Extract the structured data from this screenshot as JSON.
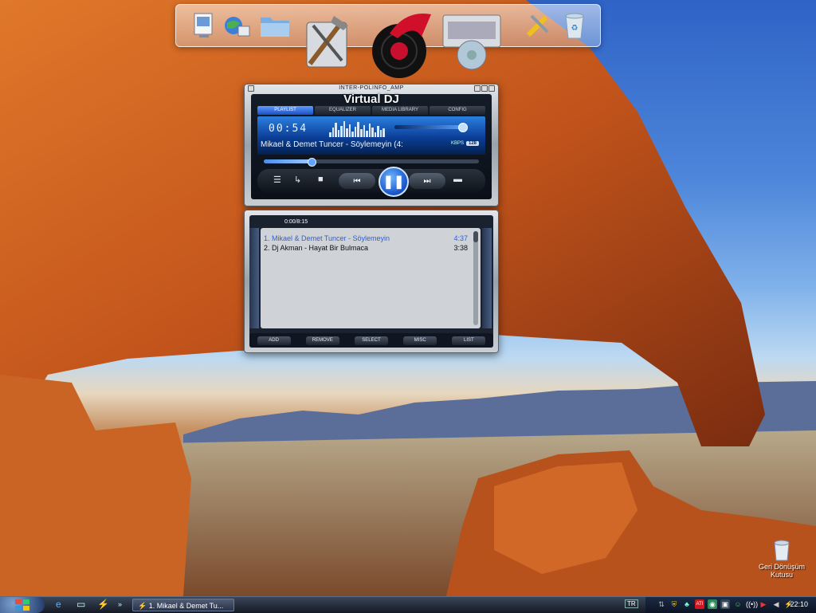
{
  "dock": {
    "items": [
      "display-settings-icon",
      "network-icon",
      "folder-icon",
      "tools-icon",
      "virtualdj-icon",
      "scanner-icon",
      "settings-icon",
      "recycle-bin-icon"
    ]
  },
  "player": {
    "window_title": "INTER-POLINFO_AMP",
    "app_title": "Virtual DJ",
    "tabs": [
      "PLAYLIST",
      "EQUALIZER",
      "MEDIA LIBRARY",
      "CONFIG"
    ],
    "active_tab": "PLAYLIST",
    "time": "00:54",
    "track_title": "Mikael & Demet Tuncer - Söylemeyin (4:",
    "kbps_label": "KBPS",
    "kbps_value": "128",
    "seek_fraction": 0.22,
    "accent": "#2f7fe6"
  },
  "playlist": {
    "time": "0:00/8:15",
    "tracks": [
      {
        "title": "1. Mikael & Demet Tuncer - Söylemeyin",
        "duration": "4:37",
        "color": "#2a5fd6"
      },
      {
        "title": "2. Dj  Akman - Hayat Bir Bulmaca",
        "duration": "3:38",
        "color": "#111111"
      }
    ],
    "buttons": [
      "ADD",
      "REMOVE",
      "SELECT",
      "MISC",
      "LIST"
    ]
  },
  "desktop": {
    "recycle_label_1": "Geri Dönüşüm",
    "recycle_label_2": "Kutusu"
  },
  "taskbar": {
    "task_label": "1. Mikael & Demet Tu...",
    "language": "TR",
    "clock": "22:10"
  }
}
